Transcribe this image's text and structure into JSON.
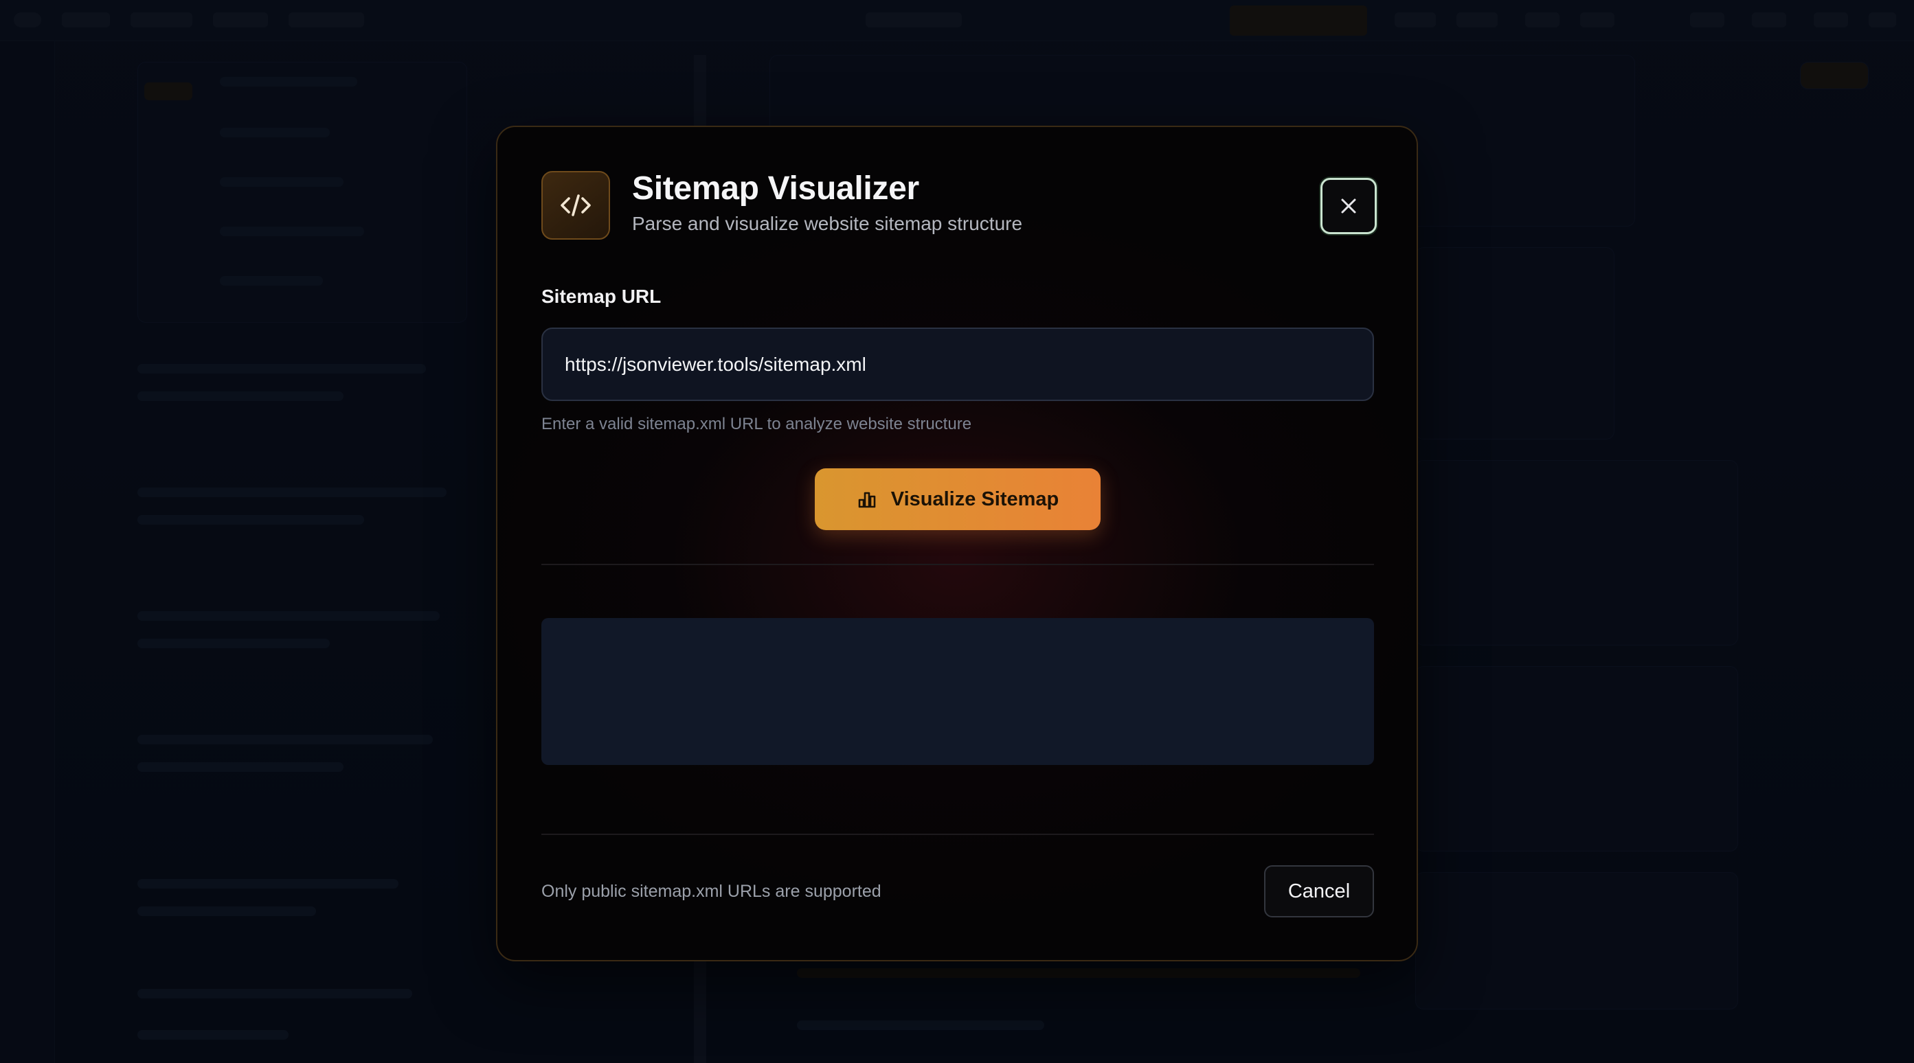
{
  "modal": {
    "title": "Sitemap Visualizer",
    "subtitle": "Parse and visualize website sitemap structure",
    "icon": "code-icon",
    "close_icon": "close-icon"
  },
  "form": {
    "label": "Sitemap URL",
    "url_value": "https://jsonviewer.tools/sitemap.xml",
    "helper": "Enter a valid sitemap.xml URL to analyze website structure",
    "submit_label": "Visualize Sitemap",
    "submit_icon": "bar-chart-icon"
  },
  "footer": {
    "note": "Only public sitemap.xml URLs are supported",
    "cancel_label": "Cancel"
  },
  "colors": {
    "accent_start": "#d9962f",
    "accent_end": "#e98236",
    "modal_bg": "#050405",
    "input_bg": "#0f1421"
  }
}
